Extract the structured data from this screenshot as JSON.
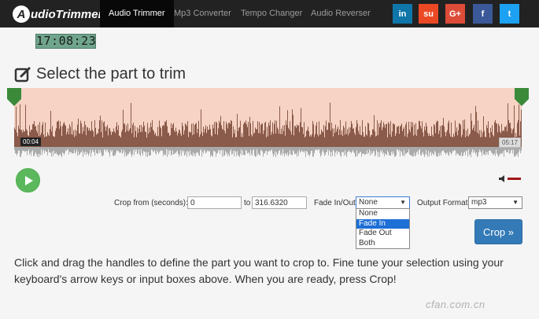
{
  "nav": {
    "logo_badge": "A",
    "logo_text": "udioTrimmer",
    "items": [
      {
        "label": "Audio Trimmer",
        "active": true
      },
      {
        "label": "Mp3 Converter",
        "active": false
      },
      {
        "label": "Tempo Changer",
        "active": false
      },
      {
        "label": "Audio Reverser",
        "active": false
      }
    ],
    "social": [
      {
        "icon": "linkedin-icon",
        "glyph": "in",
        "color": "#0e76a8"
      },
      {
        "icon": "stumbleupon-icon",
        "glyph": "su",
        "color": "#eb4924"
      },
      {
        "icon": "googleplus-icon",
        "glyph": "G+",
        "color": "#dd4b39"
      },
      {
        "icon": "facebook-icon",
        "glyph": "f",
        "color": "#3b5998"
      },
      {
        "icon": "twitter-icon",
        "glyph": "t",
        "color": "#1da1f2"
      }
    ]
  },
  "clock": "17:08:23",
  "heading": "Select the part to trim",
  "waveform": {
    "start_time": "00:04",
    "end_time": "05:17",
    "colors": {
      "selected_bg": "#f6d3c4",
      "selected_wave": "#8a5a4a",
      "outside_wave": "#aaaaaa",
      "handle": "#3a8a3a"
    }
  },
  "form": {
    "crop_from_label": "Crop from (seconds):",
    "crop_from_value": "0",
    "to_label": "to",
    "crop_to_value": "316.6320",
    "fade_label": "Fade In/Out",
    "fade_selected": "None",
    "fade_options": [
      {
        "label": "None",
        "highlighted": false
      },
      {
        "label": "Fade In",
        "highlighted": true
      },
      {
        "label": "Fade Out",
        "highlighted": false
      },
      {
        "label": "Both",
        "highlighted": false
      }
    ],
    "output_label": "Output Format",
    "output_selected": "mp3",
    "crop_button": "Crop »"
  },
  "instructions": "Click and drag the handles to define the part you want to crop to. Fine tune your selection using your keyboard's arrow keys or input boxes above. When you are ready, press Crop!",
  "watermark": "cfan.com.cn"
}
